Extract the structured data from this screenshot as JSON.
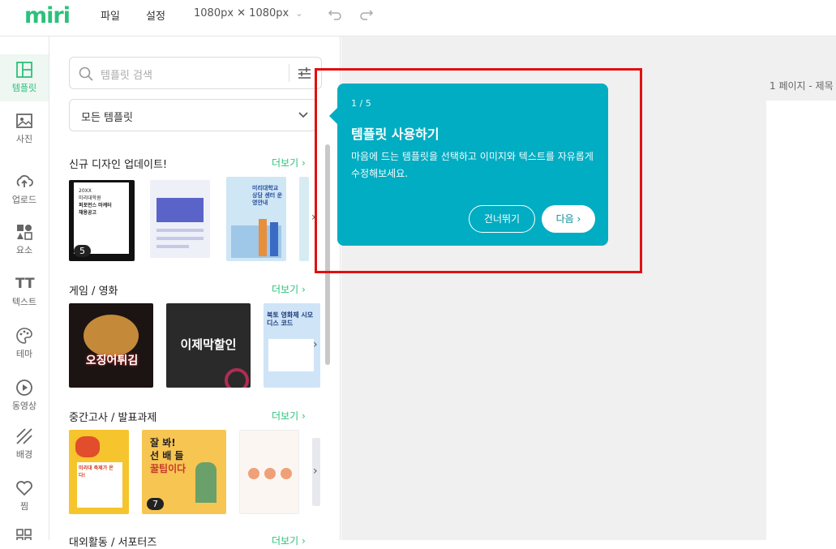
{
  "app": {
    "logo": "miri"
  },
  "topbar": {
    "menu_file": "파일",
    "menu_settings": "설정",
    "size": "1080px ✕ 1080px",
    "size_chevron": "⌄"
  },
  "leftnav": {
    "items": [
      {
        "label": "템플릿",
        "icon": "template-icon"
      },
      {
        "label": "사진",
        "icon": "photo-icon"
      },
      {
        "label": "업로드",
        "icon": "upload-icon"
      },
      {
        "label": "요소",
        "icon": "elements-icon"
      },
      {
        "label": "텍스트",
        "icon": "text-icon"
      },
      {
        "label": "테마",
        "icon": "palette-icon"
      },
      {
        "label": "동영상",
        "icon": "video-icon"
      },
      {
        "label": "배경",
        "icon": "background-icon"
      },
      {
        "label": "찜",
        "icon": "heart-icon"
      }
    ],
    "text_icon_glyph": "TT"
  },
  "panel": {
    "search_placeholder": "템플릿 검색",
    "filter_value": "모든 템플릿",
    "sections": [
      {
        "title": "신규 디자인 업데이트!",
        "more": "더보기"
      },
      {
        "title": "게임 / 영화",
        "more": "더보기"
      },
      {
        "title": "중간고사 / 발표과제",
        "more": "더보기"
      },
      {
        "title": "대외활동 / 서포터즈",
        "more": "더보기"
      }
    ],
    "thumb_texts": {
      "t1_line1": "20XX",
      "t1_line2": "미리대학원",
      "t1_line3": "퍼포먼스 마케터",
      "t1_line4": "채용공고",
      "t1_badge": "5",
      "t3_text": "미리대학교 상담 센터 운영안내",
      "t4_text": "오징어튀김",
      "t5_text": "이제막할인",
      "t6_text": "북토 영화제 시모디스 코드",
      "t7_text": "미리대 축제가 온다!",
      "t8_line1": "잘 봐!",
      "t8_line2": "선 배 들",
      "t8_line3": "꿀팁이다",
      "t8_badge": "7"
    }
  },
  "canvas": {
    "page_label": "1 페이지 - 제목"
  },
  "tooltip": {
    "step": "1 / 5",
    "title": "템플릿 사용하기",
    "desc": "마음에 드는 템플릿을 선택하고 이미지와 텍스트를 자유롭게 수정해보세요.",
    "skip": "건너뛰기",
    "next": "다음"
  },
  "colors": {
    "brand": "#2cc17b",
    "tooltip": "#00adc2",
    "highlight": "#e01010"
  }
}
